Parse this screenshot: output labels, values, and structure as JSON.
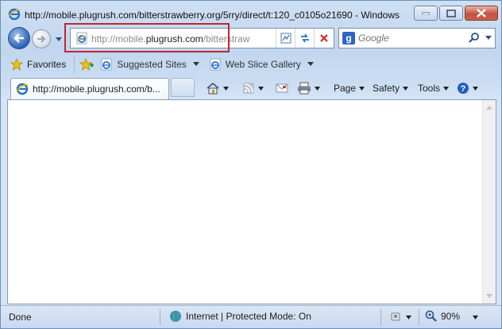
{
  "window": {
    "title": "http://mobile.plugrush.com/bitterstrawberry.org/5rry/direct/t:120_c0105o21690 - Windows"
  },
  "address": {
    "prefix": "http://mobile.",
    "domain": "plugrush.com",
    "rest": "/bitterstraw"
  },
  "search": {
    "placeholder": "Google"
  },
  "favorites_bar": {
    "favorites_label": "Favorites",
    "suggested_sites": "Suggested Sites",
    "web_slice_gallery": "Web Slice Gallery"
  },
  "tab": {
    "label": "http://mobile.plugrush.com/b..."
  },
  "command_bar": {
    "page": "Page",
    "safety": "Safety",
    "tools": "Tools"
  },
  "status": {
    "done": "Done",
    "zone": "Internet | Protected Mode: On",
    "zoom": "90%"
  },
  "colors": {
    "highlight_box": "#c0262c",
    "close_button": "#c2533e"
  }
}
